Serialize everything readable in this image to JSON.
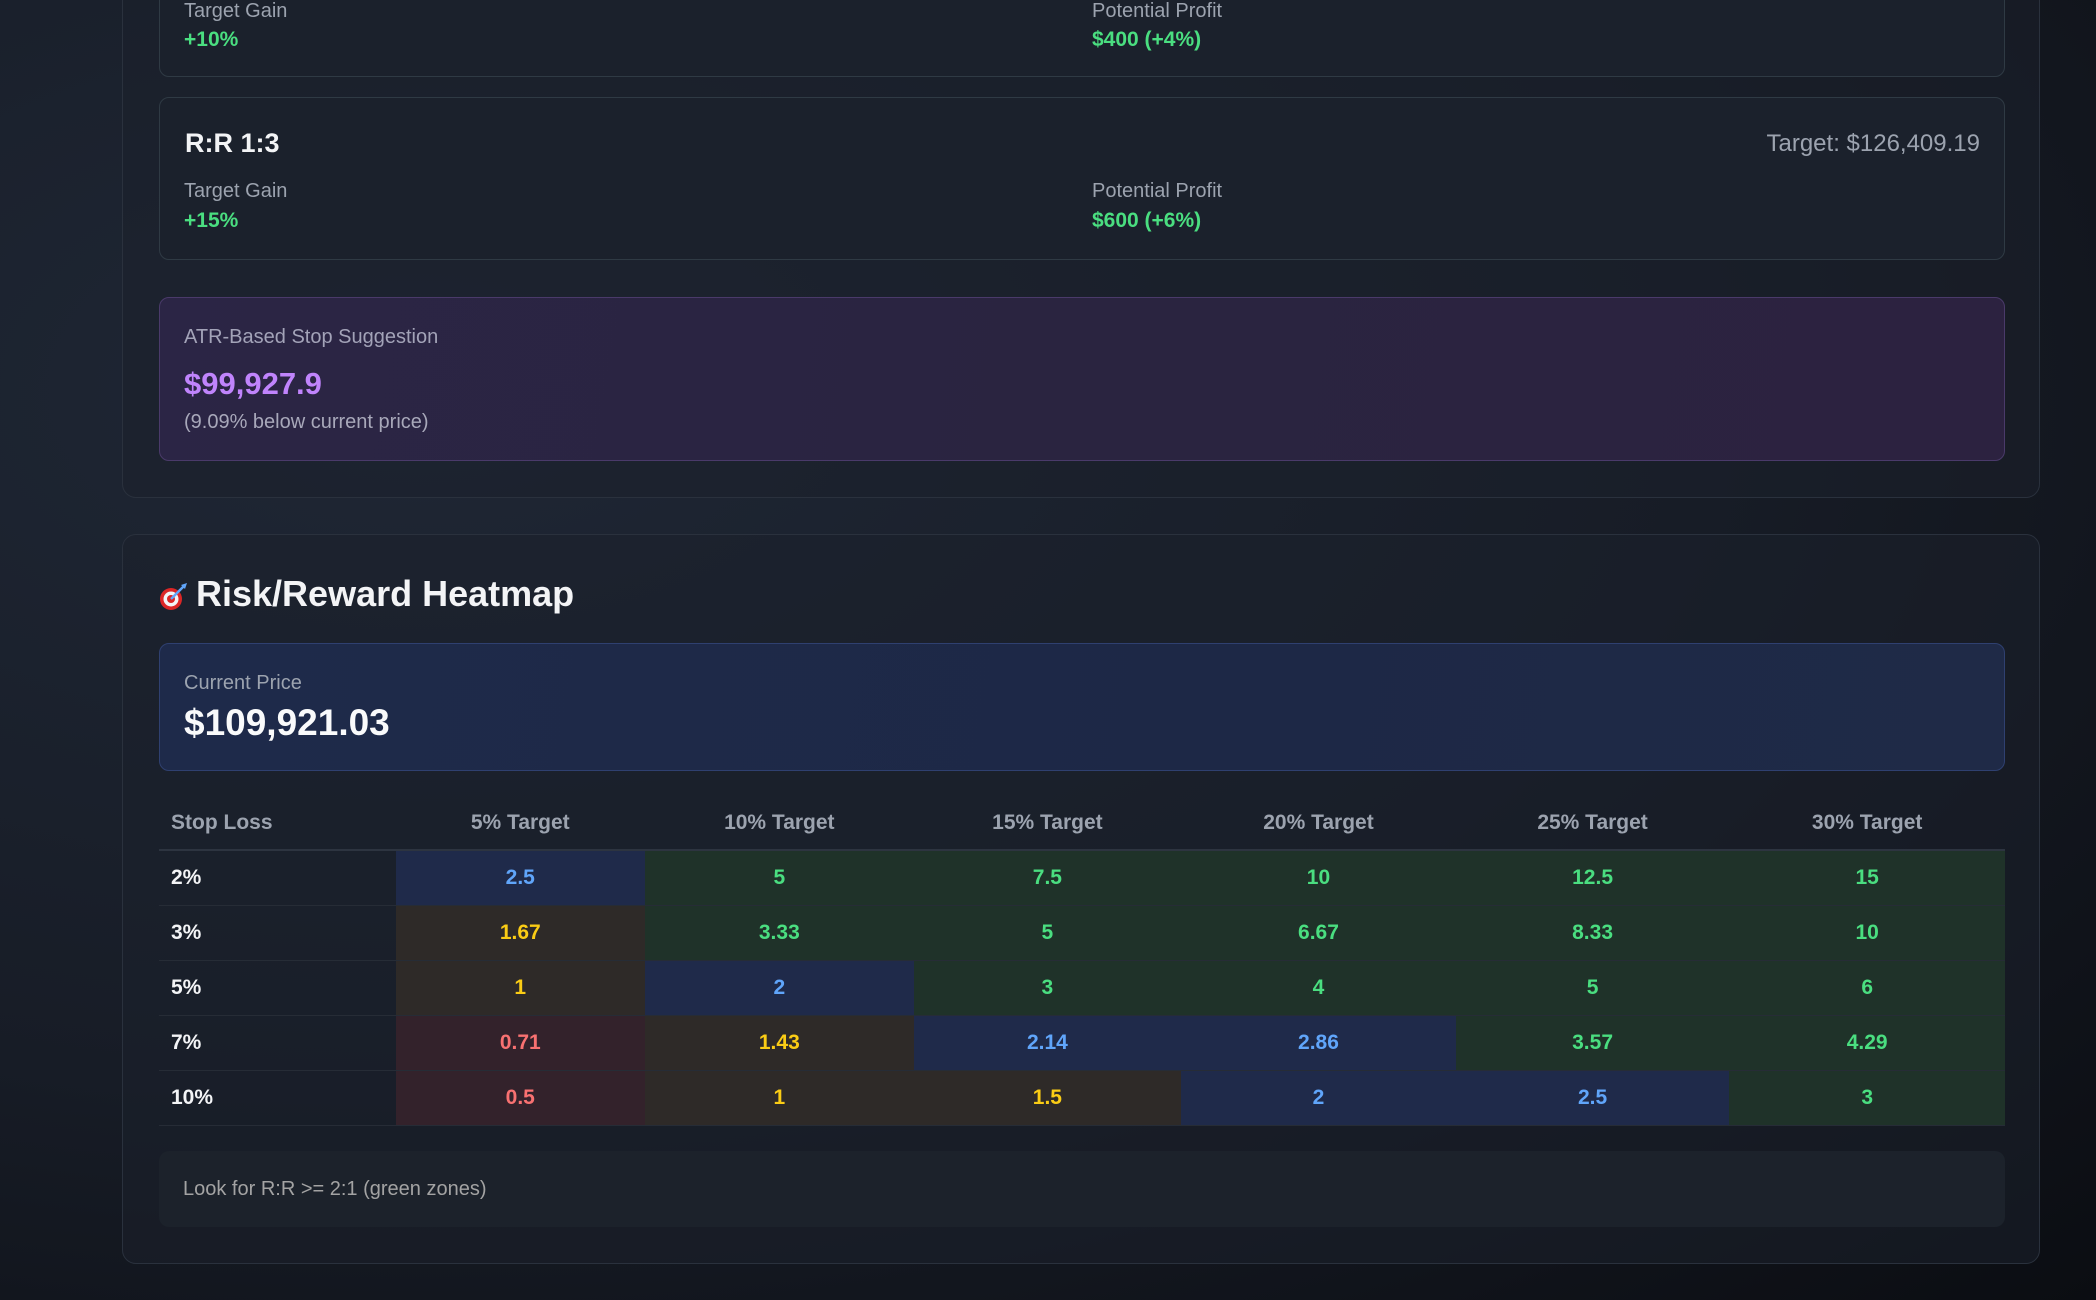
{
  "rr_partial": {
    "gain_label": "Target Gain",
    "gain_value": "+10%",
    "profit_label": "Potential Profit",
    "profit_value": "$400 (+4%)"
  },
  "rr_card": {
    "title": "R:R 1:3",
    "target": "Target: $126,409.19",
    "gain_label": "Target Gain",
    "gain_value": "+15%",
    "profit_label": "Potential Profit",
    "profit_value": "$600 (+6%)"
  },
  "atr": {
    "label": "ATR-Based Stop Suggestion",
    "value": "$99,927.9",
    "note": "(9.09% below current price)"
  },
  "heatmap": {
    "title": "Risk/Reward Heatmap",
    "icon": "dart-target-icon",
    "current_price_label": "Current Price",
    "current_price_value": "$109,921.03",
    "headers": [
      "Stop Loss",
      "5% Target",
      "10% Target",
      "15% Target",
      "20% Target",
      "25% Target",
      "30% Target"
    ],
    "rows": [
      {
        "stop": "2%",
        "values": [
          "2.5",
          "5",
          "7.5",
          "10",
          "12.5",
          "15"
        ]
      },
      {
        "stop": "3%",
        "values": [
          "1.67",
          "3.33",
          "5",
          "6.67",
          "8.33",
          "10"
        ]
      },
      {
        "stop": "5%",
        "values": [
          "1",
          "2",
          "3",
          "4",
          "5",
          "6"
        ]
      },
      {
        "stop": "7%",
        "values": [
          "0.71",
          "1.43",
          "2.14",
          "2.86",
          "3.57",
          "4.29"
        ]
      },
      {
        "stop": "10%",
        "values": [
          "0.5",
          "1",
          "1.5",
          "2",
          "2.5",
          "3"
        ]
      }
    ],
    "footer_note": "Look for R:R >= 2:1 (green zones)"
  },
  "colors": {
    "green_text": "#4ade80",
    "green_bg": "#1f3229",
    "blue_text": "#60a5fa",
    "blue_bg": "#1f2a4a",
    "yellow_text": "#facc15",
    "yellow_bg": "#2e2a28",
    "red_text": "#f87171",
    "red_bg": "#33222b",
    "purple_text": "#c084fc"
  }
}
